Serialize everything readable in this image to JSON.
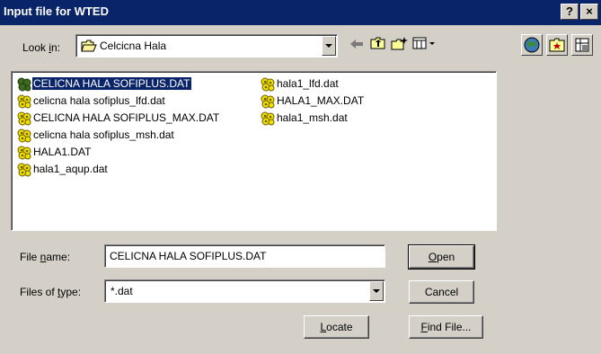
{
  "window": {
    "title": "Input file for WTED",
    "help_label": "?",
    "close_label": "×"
  },
  "look_in": {
    "label_pre": "Look ",
    "label_key": "i",
    "label_post": "n:",
    "value": "Celcicna Hala"
  },
  "toolbar": {
    "back_icon": "back-arrow-icon",
    "up_icon": "up-folder-icon",
    "new_folder_icon": "new-folder-icon",
    "views_icon": "view-menu-icon"
  },
  "files": [
    {
      "name": "CELICNA HALA SOFIPLUS.DAT",
      "selected": true
    },
    {
      "name": "celicna hala sofiplus_lfd.dat"
    },
    {
      "name": "CELICNA HALA SOFIPLUS_MAX.DAT"
    },
    {
      "name": "celicna hala sofiplus_msh.dat"
    },
    {
      "name": "HALA1.DAT"
    },
    {
      "name": "hala1_aqup.dat"
    },
    {
      "name": "hala1_lfd.dat"
    },
    {
      "name": "HALA1_MAX.DAT"
    },
    {
      "name": "hala1_msh.dat"
    }
  ],
  "file_name": {
    "label_pre": "File ",
    "label_key": "n",
    "label_post": "ame:",
    "value": "CELICNA HALA SOFIPLUS.DAT"
  },
  "file_type": {
    "label_pre": "Files of ",
    "label_key": "t",
    "label_post": "ype:",
    "value": "*.dat"
  },
  "buttons": {
    "open": {
      "key": "O",
      "rest": "pen"
    },
    "cancel": "Cancel",
    "locate": {
      "key": "L",
      "rest": "ocate"
    },
    "find": {
      "key": "F",
      "rest": "ind File..."
    }
  },
  "colors": {
    "titlebar": "#0a246a",
    "face": "#d4d0c8",
    "selection": "#0a246a"
  }
}
